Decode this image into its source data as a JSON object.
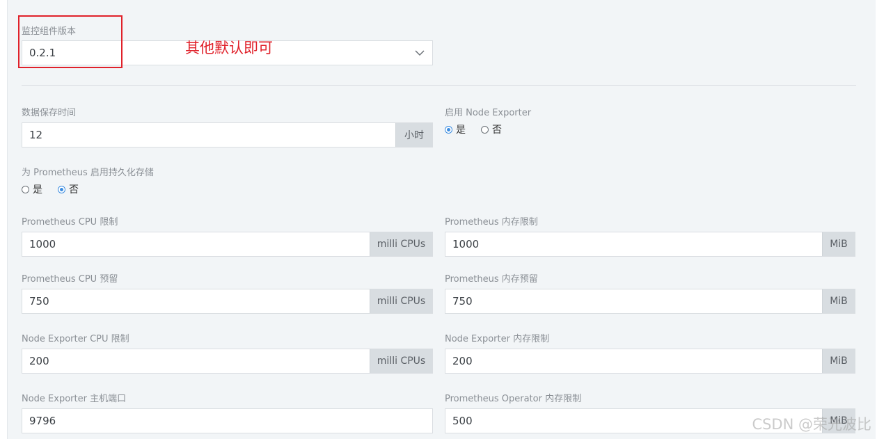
{
  "monitor_version": {
    "label": "监控组件版本",
    "value": "0.2.1"
  },
  "annotation": {
    "text": "其他默认即可",
    "color": "#e0212a"
  },
  "data_retention": {
    "label": "数据保存时间",
    "value": "12",
    "unit": "小时"
  },
  "node_exporter_enable": {
    "label": "启用 Node Exporter",
    "options": [
      "是",
      "否"
    ],
    "selected": "是"
  },
  "persistent_storage": {
    "label": "为 Prometheus 启用持久化存储",
    "options": [
      "是",
      "否"
    ],
    "selected": "否"
  },
  "prom_cpu_limit": {
    "label": "Prometheus CPU 限制",
    "value": "1000",
    "unit": "milli CPUs"
  },
  "prom_mem_limit": {
    "label": "Prometheus 内存限制",
    "value": "1000",
    "unit": "MiB"
  },
  "prom_cpu_reserve": {
    "label": "Prometheus CPU 预留",
    "value": "750",
    "unit": "milli CPUs"
  },
  "prom_mem_reserve": {
    "label": "Prometheus 内存预留",
    "value": "750",
    "unit": "MiB"
  },
  "ne_cpu_limit": {
    "label": "Node Exporter CPU 限制",
    "value": "200",
    "unit": "milli CPUs"
  },
  "ne_mem_limit": {
    "label": "Node Exporter 内存限制",
    "value": "200",
    "unit": "MiB"
  },
  "ne_host_port": {
    "label": "Node Exporter 主机端口",
    "value": "9796"
  },
  "operator_mem_limit": {
    "label": "Prometheus Operator 内存限制",
    "value": "500",
    "unit": "MiB"
  },
  "watermark": "CSDN @荣光波比",
  "colors": {
    "panel_bg": "#f2f5f7",
    "addon_bg": "#d8dde1",
    "radio_accent": "#3d8de0",
    "annotation_red": "#e0212a"
  }
}
